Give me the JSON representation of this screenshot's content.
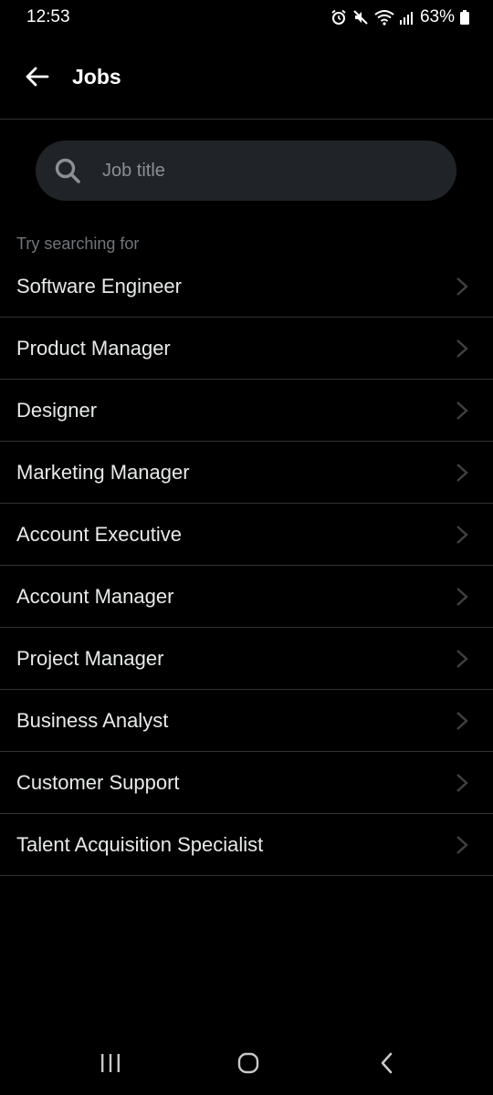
{
  "status_bar": {
    "time": "12:53",
    "battery": "63%",
    "icons": [
      "alarm-icon",
      "mute-icon",
      "wifi-icon",
      "signal-icon",
      "battery-icon"
    ]
  },
  "header": {
    "title": "Jobs",
    "back_icon": "arrow-left-icon"
  },
  "search": {
    "placeholder": "Job title",
    "value": ""
  },
  "suggestions": {
    "heading": "Try searching for",
    "items": [
      {
        "label": "Software Engineer"
      },
      {
        "label": "Product Manager"
      },
      {
        "label": "Designer"
      },
      {
        "label": "Marketing Manager"
      },
      {
        "label": "Account Executive"
      },
      {
        "label": "Account Manager"
      },
      {
        "label": "Project Manager"
      },
      {
        "label": "Business Analyst"
      },
      {
        "label": "Customer Support"
      },
      {
        "label": "Talent Acquisition Specialist"
      }
    ]
  },
  "nav_bar": {
    "buttons": [
      "recents-icon",
      "home-icon",
      "back-icon"
    ]
  },
  "colors": {
    "background": "#000000",
    "text": "#e7e9ea",
    "muted": "#71767b",
    "divider": "#2f3336",
    "search_bg": "#202327"
  }
}
